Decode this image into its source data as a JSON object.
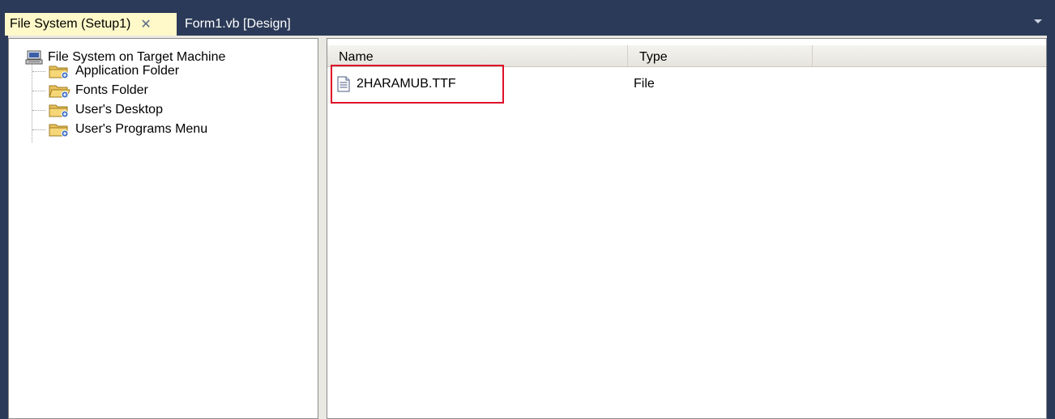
{
  "tabs": [
    {
      "label": "File System (Setup1)",
      "close": "✕"
    },
    {
      "label": "Form1.vb [Design]"
    }
  ],
  "tree": {
    "root": "File System on Target Machine",
    "items": [
      {
        "label": "Application Folder",
        "icon": "special-folder-icon"
      },
      {
        "label": "Fonts Folder",
        "icon": "fonts-folder-icon"
      },
      {
        "label": "User's Desktop",
        "icon": "special-folder-icon"
      },
      {
        "label": "User's Programs Menu",
        "icon": "special-folder-icon"
      }
    ]
  },
  "list": {
    "columns": [
      "Name",
      "Type"
    ],
    "rows": [
      {
        "name": "2HARAMUB.TTF",
        "type": "File",
        "icon": "file-icon"
      }
    ]
  },
  "colors": {
    "window_bg": "#2b3a58",
    "active_tab": "#fff8c8",
    "highlight": "#e0102a"
  }
}
